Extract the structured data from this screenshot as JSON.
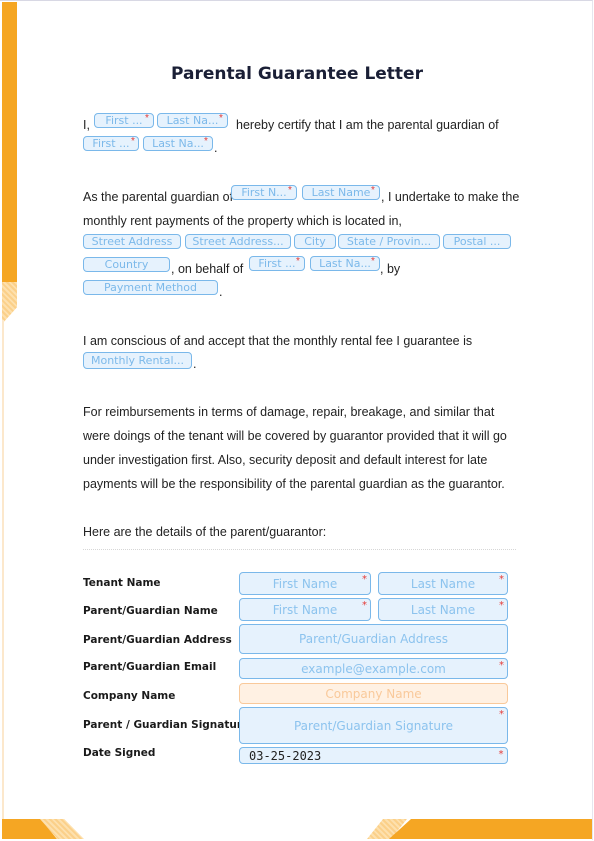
{
  "document": {
    "title": "Parental Guarantee Letter",
    "colors": {
      "accent": "#f5a623",
      "field_border": "#7ab8ea",
      "field_bg": "#e6f2fd",
      "required": "#e53935"
    }
  },
  "para1": {
    "prefix": "I,",
    "text": "hereby certify that I am the parental guardian of",
    "suffix": ".",
    "fields": [
      {
        "placeholder": "First ...",
        "required": true
      },
      {
        "placeholder": "Last Na...",
        "required": true
      },
      {
        "placeholder": "First ...",
        "required": true
      },
      {
        "placeholder": "Last Na...",
        "required": true
      }
    ]
  },
  "para2": {
    "text1": "As the parental guardian of",
    "text2": ", I undertake to make the",
    "text3": "monthly rent payments of the property which is located in,",
    "text4": ", on behalf of",
    "text5": ", by",
    "text6": ".",
    "fields": {
      "guardian_first": {
        "placeholder": "First N...",
        "required": true
      },
      "guardian_last": {
        "placeholder": "Last Name",
        "required": true
      },
      "street1": {
        "placeholder": "Street Address"
      },
      "street2": {
        "placeholder": "Street Address..."
      },
      "city": {
        "placeholder": "City"
      },
      "state": {
        "placeholder": "State / Provin..."
      },
      "postal": {
        "placeholder": "Postal ..."
      },
      "country": {
        "placeholder": "Country"
      },
      "behalf_first": {
        "placeholder": "First ...",
        "required": true
      },
      "behalf_last": {
        "placeholder": "Last Na...",
        "required": true
      },
      "payment": {
        "placeholder": "Payment Method"
      }
    }
  },
  "para3": {
    "text": "I am conscious of and accept that the monthly rental fee I guarantee is",
    "suffix": ".",
    "field": {
      "placeholder": "Monthly Rental..."
    }
  },
  "para4": {
    "text": "For reimbursements in terms of damage, repair, breakage, and similar that were doings of the tenant will be covered by guarantor provided that it will go under investigation first. Also, security deposit and default interest for late payments will be the responsibility of the parental guardian as the guarantor."
  },
  "para5": {
    "text": "Here are the details of the parent/guarantor:"
  },
  "details": {
    "tenant_name": {
      "label": "Tenant Name",
      "first": "First Name",
      "last": "Last Name"
    },
    "guardian_name": {
      "label": "Parent/Guardian Name",
      "first": "First Name",
      "last": "Last Name"
    },
    "guardian_address": {
      "label": "Parent/Guardian Address",
      "placeholder": "Parent/Guardian Address"
    },
    "guardian_email": {
      "label": "Parent/Guardian Email",
      "placeholder": "example@example.com"
    },
    "company_name": {
      "label": "Company Name",
      "placeholder": "Company Name"
    },
    "signature": {
      "label": "Parent / Guardian Signature",
      "placeholder": "Parent/Guardian Signature"
    },
    "date_signed": {
      "label": "Date Signed",
      "value": "03-25-2023"
    }
  },
  "required_mark": "*"
}
